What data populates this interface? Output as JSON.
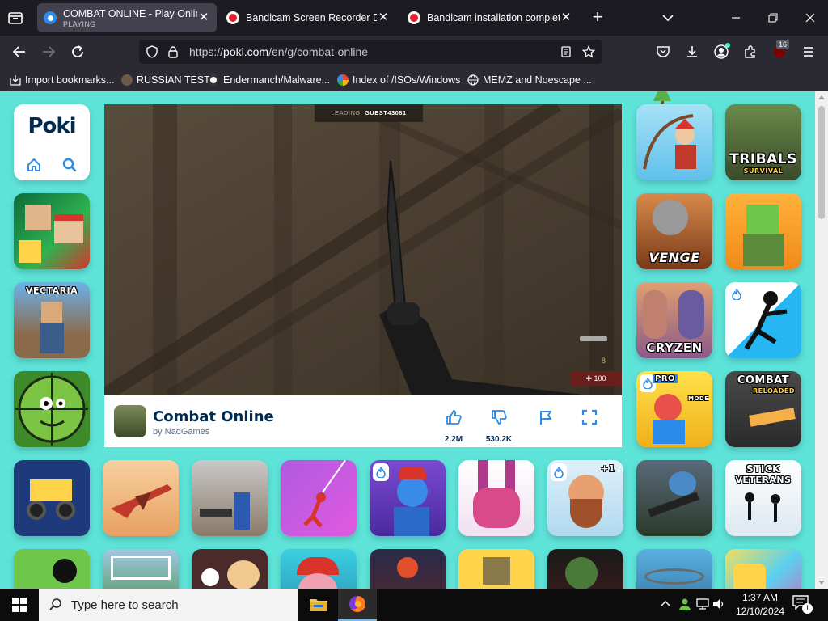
{
  "browser": {
    "tabs": [
      {
        "title": "COMBAT ONLINE - Play Online",
        "subtitle": "PLAYING",
        "active": true
      },
      {
        "title": "Bandicam Screen Recorder Dow",
        "active": false
      },
      {
        "title": "Bandicam installation complete",
        "active": false
      }
    ],
    "url_prefix": "https://",
    "url_host": "poki.com",
    "url_path": "/en/g/combat-online",
    "extension_badge": "16"
  },
  "bookmarks": [
    {
      "label": "Import bookmarks...",
      "icon": "import-icon"
    },
    {
      "label": "RUSSIAN TEST",
      "icon": "site-icon"
    },
    {
      "label": "Endermanch/Malware...",
      "icon": "github-icon"
    },
    {
      "label": "Index of /ISOs/Windows",
      "icon": "google-icon"
    },
    {
      "label": "MEMZ and Noescape ...",
      "icon": "globe-icon"
    }
  ],
  "poki": {
    "logo": "Poki",
    "game": {
      "title": "Combat Online",
      "author": "by NadGames",
      "likes": "2.2M",
      "dislikes": "530.2K",
      "leading_label": "LEADING:",
      "leading_player": "GUEST43081",
      "hud_ammo": "8",
      "hud_health": "100"
    },
    "thumbnails": {
      "tribals_title": "TRIBALS",
      "tribals_subtitle": "SURVIVAL",
      "venge": "VENGE",
      "vectaria": "VECTARIA",
      "cryzen": "CRYZEN",
      "pro_badge": "PRO",
      "mode_text": "MODE",
      "combat_title": "COMBAT",
      "combat_subtitle": "RELOADED",
      "stick_title": "STICK",
      "stick_subtitle": "VETERANS",
      "plus_one": "+1"
    }
  },
  "taskbar": {
    "search_placeholder": "Type here to search",
    "time": "1:37 AM",
    "date": "12/10/2024",
    "notification_count": "1"
  },
  "colors": {
    "page_bg": "#5ee3d9",
    "poki_blue": "#002b50",
    "firefox_dark": "#1c1b22"
  }
}
